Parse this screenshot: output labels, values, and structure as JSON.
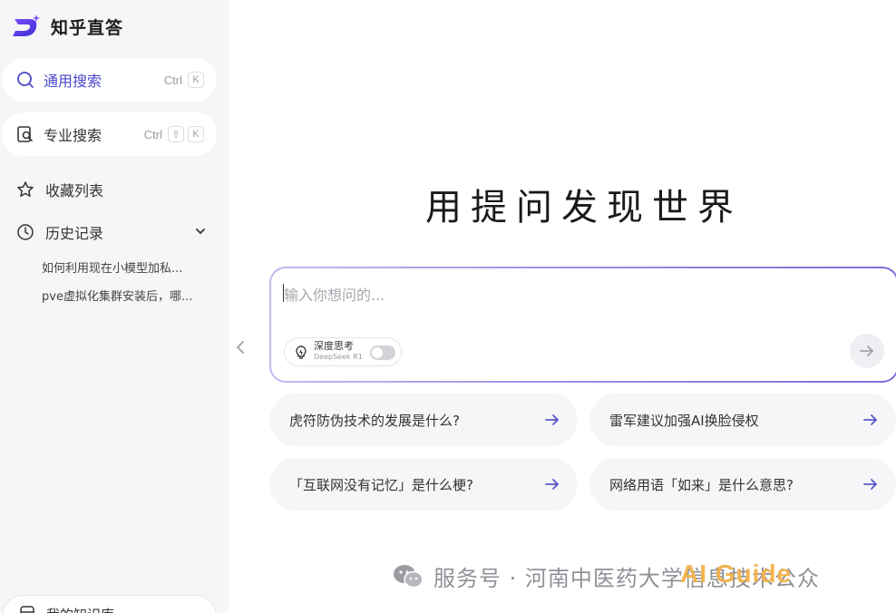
{
  "brand": {
    "name": "知乎直答",
    "logo_letter": "D"
  },
  "sidebar": {
    "general_search": {
      "label": "通用搜索",
      "shortcut": [
        "Ctrl",
        "K"
      ]
    },
    "pro_search": {
      "label": "专业搜索",
      "shortcut": [
        "Ctrl",
        "⇧",
        "K"
      ]
    },
    "favorites": {
      "label": "收藏列表"
    },
    "history": {
      "label": "历史记录",
      "items": [
        "如何利用现在小模型加私...",
        "pve虚拟化集群安装后，哪..."
      ]
    },
    "knowledge_base": {
      "label": "我的知识库"
    }
  },
  "main": {
    "hero_title": "用提问发现世界",
    "input": {
      "placeholder": "输入你想问的..."
    },
    "deep_think": {
      "title": "深度思考",
      "subtitle": "DeepSeek R1",
      "enabled": false
    },
    "suggestions": [
      "虎符防伪技术的发展是什么?",
      "雷军建议加强AI换脸侵权",
      "「互联网没有记忆」是什么梗?",
      "网络用语「如来」是什么意思?"
    ]
  },
  "watermark": {
    "text": "服务号 · 河南中医药大学信息技术公众",
    "overlay": "AI Guide"
  },
  "colors": {
    "accent": "#4a47c9",
    "sidebar_bg": "#f5f6f8",
    "suggestion_bg": "#f5f6f8",
    "brand_gradient_start": "#7b4dff",
    "arrow": "#5b56c9"
  }
}
